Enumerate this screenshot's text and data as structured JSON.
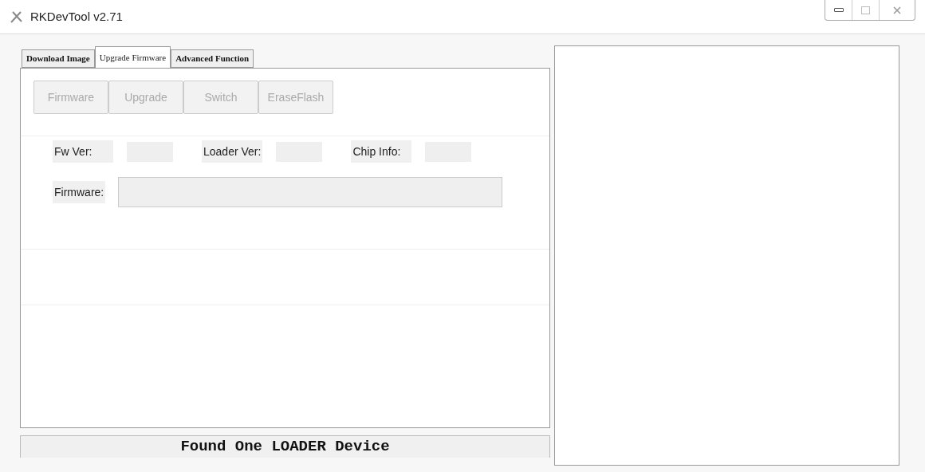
{
  "window": {
    "title": "RKDevTool v2.71"
  },
  "tabs": [
    {
      "label": "Download Image",
      "selected": false
    },
    {
      "label": "Upgrade Firmware",
      "selected": true
    },
    {
      "label": "Advanced Function",
      "selected": false
    }
  ],
  "buttons": [
    {
      "label": "Firmware",
      "disabled": true
    },
    {
      "label": "Upgrade",
      "disabled": true
    },
    {
      "label": "Switch",
      "disabled": true
    },
    {
      "label": "EraseFlash",
      "disabled": true
    }
  ],
  "info": [
    {
      "label": "Fw Ver:"
    },
    {
      "label": "Loader Ver:"
    },
    {
      "label": "Chip Info:"
    }
  ],
  "firmware_field": {
    "label": "Firmware:"
  },
  "status_bar": "Found One LOADER Device"
}
